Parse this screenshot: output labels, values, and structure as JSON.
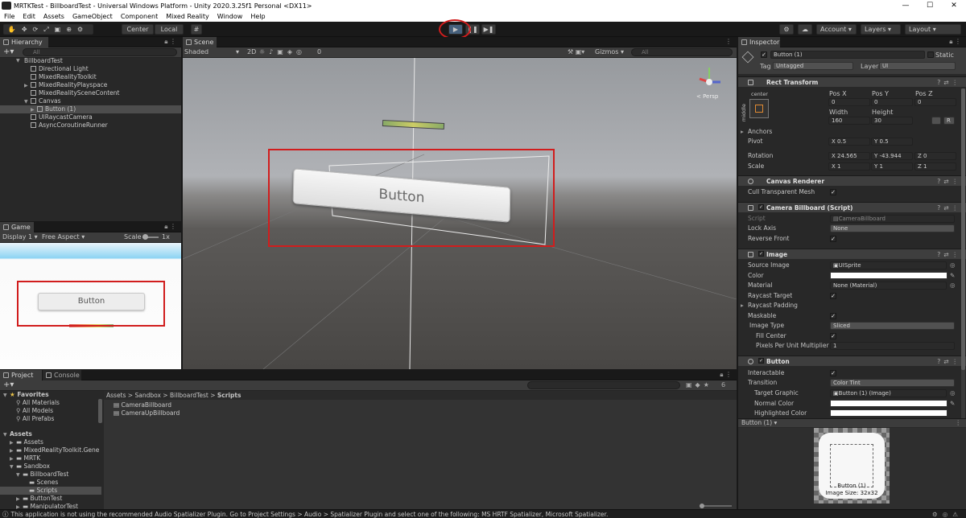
{
  "window": {
    "title": "MRTKTest - BillboardTest - Universal Windows Platform - Unity 2020.3.25f1 Personal <DX11>",
    "min": "—",
    "max": "☐",
    "close": "✕"
  },
  "menu": [
    "File",
    "Edit",
    "Assets",
    "GameObject",
    "Component",
    "Mixed Reality",
    "Window",
    "Help"
  ],
  "toolbar": {
    "center": "Center",
    "local": "Local",
    "account": "Account",
    "layers": "Layers",
    "layout": "Layout",
    "play": "▶",
    "pause": "❚❚",
    "step": "▶❚"
  },
  "hierarchy": {
    "tab": "Hierarchy",
    "search_placeholder": "All",
    "items": [
      "BillboardTest",
      "Directional Light",
      "MixedRealityToolkit",
      "MixedRealityPlayspace",
      "MixedRealitySceneContent",
      "Canvas",
      "Button (1)",
      "UIRaycastCamera",
      "AsyncCoroutineRunner"
    ]
  },
  "game": {
    "tab": "Game",
    "display": "Display 1",
    "aspect": "Free Aspect",
    "scale_label": "Scale",
    "scale_value": "1x",
    "button_label": "Button"
  },
  "scene": {
    "tab": "Scene",
    "shading": "Shaded",
    "mode2d": "2D",
    "gizmos": "Gizmos",
    "search_placeholder": "All",
    "button_label": "Button",
    "persp": "< Persp",
    "hidden_count": "0"
  },
  "project": {
    "tab": "Project",
    "console_tab": "Console",
    "favorites": "Favorites",
    "fav_items": [
      "All Materials",
      "All Models",
      "All Prefabs"
    ],
    "assets": "Assets",
    "asset_items": [
      "Assets",
      "MixedRealityToolkit.Gene",
      "MRTK",
      "Sandbox",
      "BillboardTest",
      "Scenes",
      "Scripts",
      "ButtonTest",
      "ManipulatorTest"
    ],
    "breadcrumb": [
      "Assets",
      "Sandbox",
      "BillboardTest",
      "Scripts"
    ],
    "files": [
      "CameraBillboard",
      "CameraUpBillboard"
    ],
    "hidden_count": "6"
  },
  "inspector": {
    "tab": "Inspector",
    "object_name": "Button (1)",
    "static_label": "Static",
    "tag_label": "Tag",
    "tag_value": "Untagged",
    "layer_label": "Layer",
    "layer_value": "UI",
    "rect": {
      "title": "Rect Transform",
      "anchor_h": "center",
      "anchor_v": "middle",
      "posx_label": "Pos X",
      "posy_label": "Pos Y",
      "posz_label": "Pos Z",
      "posx": "0",
      "posy": "0",
      "posz": "0",
      "width_label": "Width",
      "height_label": "Height",
      "width": "160",
      "height": "30",
      "r_btn": "R",
      "anchors": "Anchors",
      "pivot": "Pivot",
      "pivot_x": "0.5",
      "pivot_y": "0.5",
      "rotation": "Rotation",
      "rot_x": "24.565",
      "rot_y": "-43.944",
      "rot_z": "0",
      "scale": "Scale",
      "scale_x": "1",
      "scale_y": "1",
      "scale_z": "1"
    },
    "canvas_renderer": {
      "title": "Canvas Renderer",
      "cull": "Cull Transparent Mesh"
    },
    "billboard": {
      "title": "Camera Billboard (Script)",
      "script_label": "Script",
      "script_value": "CameraBillboard",
      "lock_axis": "Lock Axis",
      "lock_value": "None",
      "reverse": "Reverse Front"
    },
    "image": {
      "title": "Image",
      "source": "Source Image",
      "source_value": "UISprite",
      "color": "Color",
      "material": "Material",
      "material_value": "None (Material)",
      "raycast_target": "Raycast Target",
      "raycast_padding": "Raycast Padding",
      "maskable": "Maskable",
      "image_type": "Image Type",
      "image_type_value": "Sliced",
      "fill_center": "Fill Center",
      "ppu": "Pixels Per Unit Multiplier",
      "ppu_value": "1"
    },
    "button": {
      "title": "Button",
      "interactable": "Interactable",
      "transition": "Transition",
      "transition_value": "Color Tint",
      "target_graphic": "Target Graphic",
      "target_value": "Button (1) (Image)",
      "normal": "Normal Color",
      "highlighted": "Highlighted Color"
    },
    "preview": {
      "title": "Button (1)",
      "caption": "Button (1)",
      "size": "Image Size: 32x32"
    }
  },
  "statusbar": {
    "message": "This application is not using the recommended Audio Spatializer Plugin. Go to Project Settings > Audio > Spatializer Plugin and select one of the following: MS HRTF Spatializer, Microsoft Spatializer."
  },
  "colors": {
    "highlight_red": "#d11d1d",
    "play_blue": "#46607c"
  }
}
